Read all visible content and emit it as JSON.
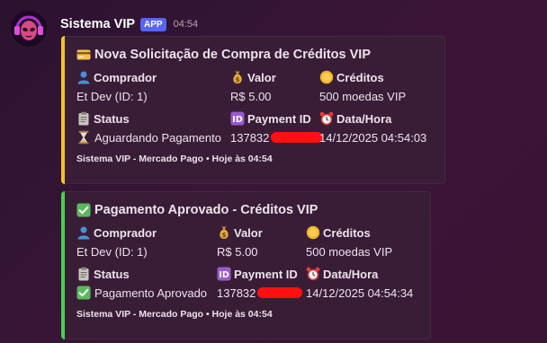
{
  "message": {
    "username": "Sistema VIP",
    "app_badge": "APP",
    "time": "04:54"
  },
  "colors": {
    "pending_bar": "#f5c518",
    "approved_bar": "#3ed54a",
    "app_badge": "#5865f2",
    "redaction": "#ff1010"
  },
  "embeds": [
    {
      "title": "Nova Solicitação de Compra de Créditos VIP",
      "title_icon": "credit-card-icon",
      "fields": {
        "buyer_label": "Comprador",
        "buyer_value": "Et Dev (ID: 1)",
        "value_label": "Valor",
        "value_value": "R$ 5.00",
        "credits_label": "Créditos",
        "credits_value": "500 moedas VIP",
        "status_label": "Status",
        "status_value": "Aguardando Pagamento",
        "status_icon": "hourglass-icon",
        "payment_label": "Payment ID",
        "payment_value": "137832",
        "date_label": "Data/Hora",
        "date_value": "14/12/2025 04:54:03"
      },
      "footer": "Sistema VIP - Mercado Pago • Hoje às 04:54"
    },
    {
      "title": "Pagamento Aprovado - Créditos VIP",
      "title_icon": "check-mark-icon",
      "fields": {
        "buyer_label": "Comprador",
        "buyer_value": "Et Dev (ID: 1)",
        "value_label": "Valor",
        "value_value": "R$ 5.00",
        "credits_label": "Créditos",
        "credits_value": "500 moedas VIP",
        "status_label": "Status",
        "status_value": "Pagamento Aprovado",
        "status_icon": "check-mark-icon",
        "payment_label": "Payment ID",
        "payment_value": "137832",
        "date_label": "Data/Hora",
        "date_value": "14/12/2025 04:54:34"
      },
      "footer": "Sistema VIP - Mercado Pago • Hoje às 04:54"
    }
  ]
}
